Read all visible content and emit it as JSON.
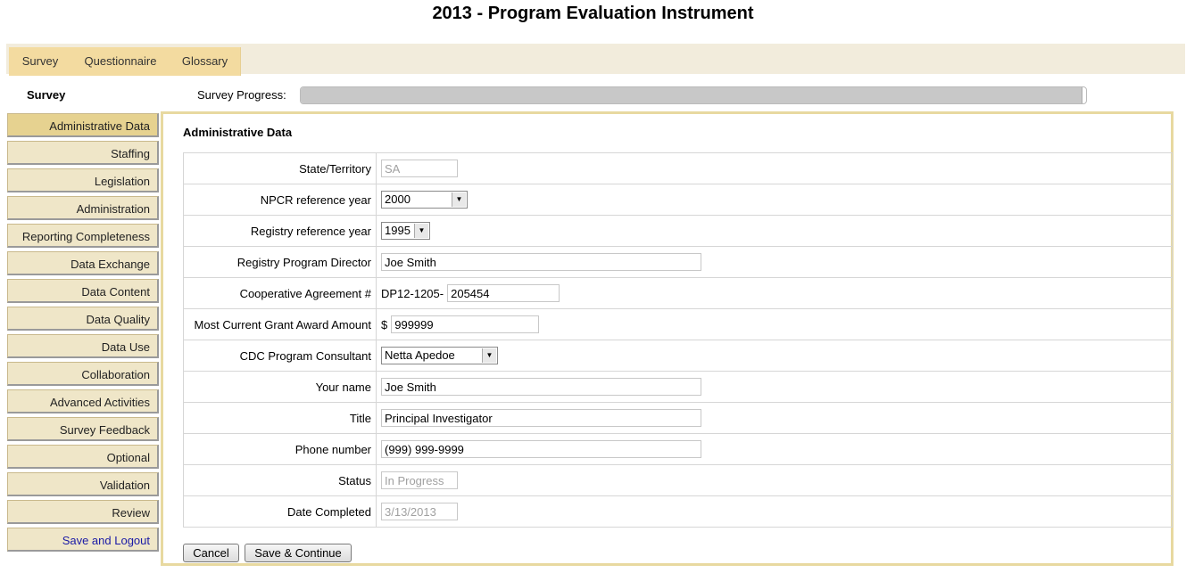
{
  "page_title": "2013 - Program Evaluation Instrument",
  "tabs": [
    "Survey",
    "Questionnaire",
    "Glossary"
  ],
  "survey_heading": "Survey",
  "progress": {
    "label": "Survey Progress:",
    "value_fraction": 0.995
  },
  "sidebar": {
    "items": [
      {
        "label": "Administrative Data",
        "active": true
      },
      {
        "label": "Staffing"
      },
      {
        "label": "Legislation"
      },
      {
        "label": "Administration"
      },
      {
        "label": "Reporting Completeness"
      },
      {
        "label": "Data Exchange"
      },
      {
        "label": "Data Content"
      },
      {
        "label": "Data Quality"
      },
      {
        "label": "Data Use"
      },
      {
        "label": "Collaboration"
      },
      {
        "label": "Advanced Activities"
      },
      {
        "label": "Survey Feedback"
      },
      {
        "label": "Optional"
      },
      {
        "label": "Validation"
      },
      {
        "label": "Review"
      }
    ],
    "logout_label": "Save and Logout"
  },
  "form": {
    "title": "Administrative Data",
    "fields": [
      {
        "label": "State/Territory",
        "value": "SA",
        "disabled": true
      },
      {
        "label": "NPCR reference year",
        "value": "2000"
      },
      {
        "label": "Registry reference year",
        "value": "1995"
      },
      {
        "label": "Registry Program Director",
        "value": "Joe Smith"
      },
      {
        "label": "Cooperative Agreement #",
        "prefix": "DP12-1205-",
        "value": "205454"
      },
      {
        "label": "Most Current Grant Award Amount",
        "prefix": "$",
        "value": "999999"
      },
      {
        "label": "CDC Program Consultant",
        "value": "Netta Apedoe"
      },
      {
        "label": "Your name",
        "value": "Joe Smith"
      },
      {
        "label": "Title",
        "value": "Principal Investigator"
      },
      {
        "label": "Phone number",
        "value": "(999) 999-9999"
      },
      {
        "label": "Status",
        "value": "In Progress",
        "disabled": true
      },
      {
        "label": "Date Completed",
        "value": "3/13/2013",
        "disabled": true
      }
    ]
  },
  "buttons": {
    "cancel": "Cancel",
    "save_continue": "Save & Continue"
  }
}
